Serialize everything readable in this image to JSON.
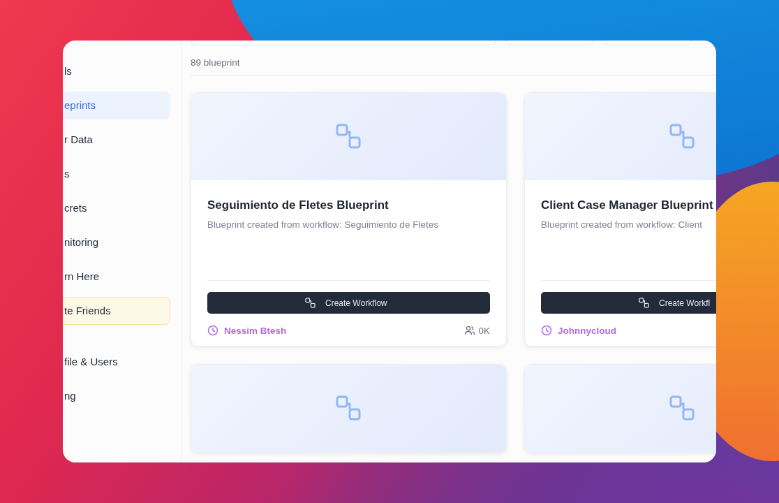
{
  "sidebar": {
    "groups": [
      {
        "items": [
          {
            "label": "ls",
            "selected": false,
            "kind": "link"
          },
          {
            "label": "eprints",
            "selected": true,
            "kind": "link"
          },
          {
            "label": "r Data",
            "selected": false,
            "kind": "link"
          },
          {
            "label": "s",
            "selected": false,
            "kind": "link"
          },
          {
            "label": "crets",
            "selected": false,
            "kind": "link"
          },
          {
            "label": "nitoring",
            "selected": false,
            "kind": "link"
          },
          {
            "label": "rn Here",
            "selected": false,
            "kind": "link"
          },
          {
            "label": "te Friends",
            "selected": false,
            "kind": "promo"
          }
        ]
      },
      {
        "items": [
          {
            "label": "file & Users",
            "selected": false,
            "kind": "link"
          },
          {
            "label": "ng",
            "selected": false,
            "kind": "link"
          }
        ]
      }
    ]
  },
  "count": "89 blueprint",
  "cards": [
    {
      "kind": "full",
      "title": "Seguimiento de Fletes Blueprint",
      "description": "Blueprint created from workflow: Seguimiento de Fletes",
      "button": "Create Workflow",
      "author": "Nessim Btesh",
      "users": "0K"
    },
    {
      "kind": "full",
      "title": "Client Case Manager Blueprint",
      "description": "Blueprint created from workflow: Client",
      "button": "Create Workfl",
      "author": "Johnnycloud"
    },
    {
      "kind": "preview"
    },
    {
      "kind": "preview"
    }
  ]
}
